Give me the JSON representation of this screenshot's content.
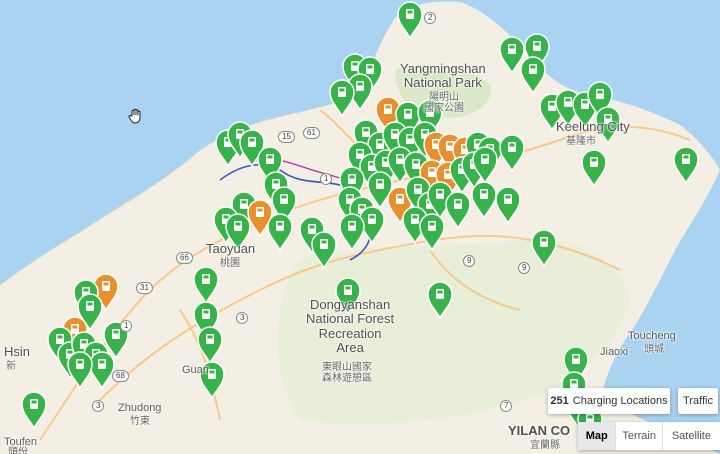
{
  "map": {
    "labels": {
      "yangmingshan": "Yangmingshan\nNational Park",
      "yangmingshan_cjk": "陽明山\n國家公園",
      "keelung": "Keelung City",
      "keelung_cjk": "基隆市",
      "taoyuan": "Taoyuan",
      "taoyuan_cjk": "桃園",
      "dongyanshan": "Dongyanshan\nNational Forest\nRecreation\nArea",
      "dongyanshan_cjk": "東眼山國家\n森林遊憩區",
      "toucheng": "Toucheng",
      "toucheng_cjk": "頭城",
      "jiaoxi": "Jiaoxi",
      "zhudong": "Zhudong",
      "zhudong_cjk": "竹東",
      "hsinchu": "Hsin",
      "hsinchu_cjk": "新",
      "guanxi": "Guan",
      "toufen": "Toufen",
      "toufen_cjk": "頭份",
      "yilan": "YILAN CO",
      "yilan_cjk": "宜蘭縣"
    },
    "road_shields": [
      "2",
      "15",
      "61",
      "1",
      "66",
      "31",
      "1",
      "68",
      "3",
      "9",
      "9",
      "7",
      "3"
    ],
    "colors": {
      "sea": "#a9d3f1",
      "land": "#f4efe4",
      "park": "#d9e9c6",
      "road": "#f7c98a",
      "pin_green": "#37b34a",
      "pin_orange": "#e8902c"
    },
    "icons": {
      "pin": "charging-station-pin-icon",
      "cursor": "hand-cursor-icon"
    }
  },
  "controls": {
    "count": "251",
    "count_label": "Charging Locations",
    "traffic": "Traffic",
    "map_types": [
      "Map",
      "Terrain",
      "Satellite"
    ],
    "selected_map_type": "Map"
  }
}
